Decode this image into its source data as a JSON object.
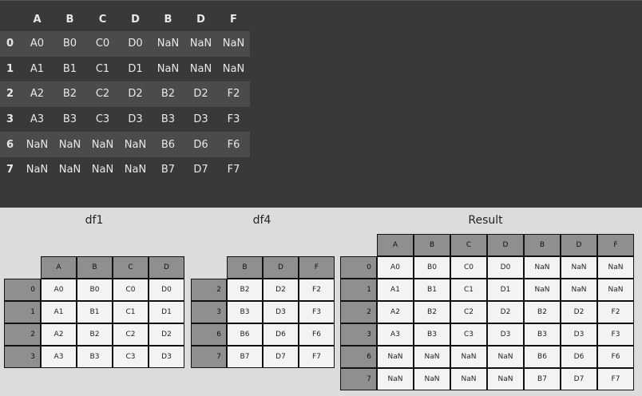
{
  "output": {
    "columns": [
      "A",
      "B",
      "C",
      "D",
      "B",
      "D",
      "F"
    ],
    "rows": [
      {
        "index": "0",
        "cells": [
          "A0",
          "B0",
          "C0",
          "D0",
          "NaN",
          "NaN",
          "NaN"
        ]
      },
      {
        "index": "1",
        "cells": [
          "A1",
          "B1",
          "C1",
          "D1",
          "NaN",
          "NaN",
          "NaN"
        ]
      },
      {
        "index": "2",
        "cells": [
          "A2",
          "B2",
          "C2",
          "D2",
          "B2",
          "D2",
          "F2"
        ]
      },
      {
        "index": "3",
        "cells": [
          "A3",
          "B3",
          "C3",
          "D3",
          "B3",
          "D3",
          "F3"
        ]
      },
      {
        "index": "6",
        "cells": [
          "NaN",
          "NaN",
          "NaN",
          "NaN",
          "B6",
          "D6",
          "F6"
        ]
      },
      {
        "index": "7",
        "cells": [
          "NaN",
          "NaN",
          "NaN",
          "NaN",
          "B7",
          "D7",
          "F7"
        ]
      }
    ]
  },
  "diagram": {
    "df1": {
      "title": "df1",
      "columns": [
        "A",
        "B",
        "C",
        "D"
      ],
      "rows": [
        {
          "index": "0",
          "cells": [
            "A0",
            "B0",
            "C0",
            "D0"
          ]
        },
        {
          "index": "1",
          "cells": [
            "A1",
            "B1",
            "C1",
            "D1"
          ]
        },
        {
          "index": "2",
          "cells": [
            "A2",
            "B2",
            "C2",
            "D2"
          ]
        },
        {
          "index": "3",
          "cells": [
            "A3",
            "B3",
            "C3",
            "D3"
          ]
        }
      ]
    },
    "df4": {
      "title": "df4",
      "columns": [
        "B",
        "D",
        "F"
      ],
      "rows": [
        {
          "index": "2",
          "cells": [
            "B2",
            "D2",
            "F2"
          ]
        },
        {
          "index": "3",
          "cells": [
            "B3",
            "D3",
            "F3"
          ]
        },
        {
          "index": "6",
          "cells": [
            "B6",
            "D6",
            "F6"
          ]
        },
        {
          "index": "7",
          "cells": [
            "B7",
            "D7",
            "F7"
          ]
        }
      ]
    },
    "result": {
      "title": "Result",
      "columns": [
        "A",
        "B",
        "C",
        "D",
        "B",
        "D",
        "F"
      ],
      "rows": [
        {
          "index": "0",
          "cells": [
            "A0",
            "B0",
            "C0",
            "D0",
            "NaN",
            "NaN",
            "NaN"
          ]
        },
        {
          "index": "1",
          "cells": [
            "A1",
            "B1",
            "C1",
            "D1",
            "NaN",
            "NaN",
            "NaN"
          ]
        },
        {
          "index": "2",
          "cells": [
            "A2",
            "B2",
            "C2",
            "D2",
            "B2",
            "D2",
            "F2"
          ]
        },
        {
          "index": "3",
          "cells": [
            "A3",
            "B3",
            "C3",
            "D3",
            "B3",
            "D3",
            "F3"
          ]
        },
        {
          "index": "6",
          "cells": [
            "NaN",
            "NaN",
            "NaN",
            "NaN",
            "B6",
            "D6",
            "F6"
          ]
        },
        {
          "index": "7",
          "cells": [
            "NaN",
            "NaN",
            "NaN",
            "NaN",
            "B7",
            "D7",
            "F7"
          ]
        }
      ]
    }
  }
}
